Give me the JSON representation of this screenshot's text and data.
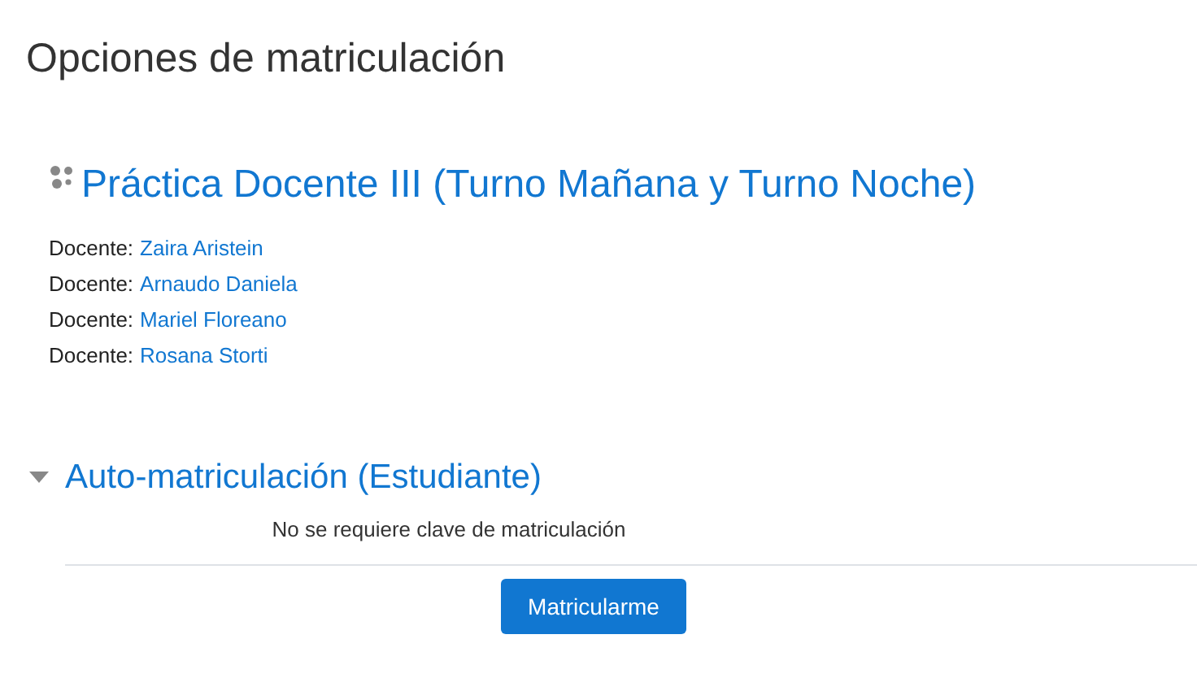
{
  "page_title": "Opciones de matriculación",
  "course": {
    "title": "Práctica Docente III (Turno Mañana y Turno Noche)",
    "teachers": [
      {
        "role": "Docente:",
        "name": "Zaira Aristein"
      },
      {
        "role": "Docente:",
        "name": "Arnaudo Daniela"
      },
      {
        "role": "Docente:",
        "name": "Mariel Floreano"
      },
      {
        "role": "Docente:",
        "name": "Rosana Storti"
      }
    ]
  },
  "enrol_section": {
    "title": "Auto-matriculación (Estudiante)",
    "expanded": true,
    "note": "No se requiere clave de matriculación",
    "button": "Matricularme"
  }
}
